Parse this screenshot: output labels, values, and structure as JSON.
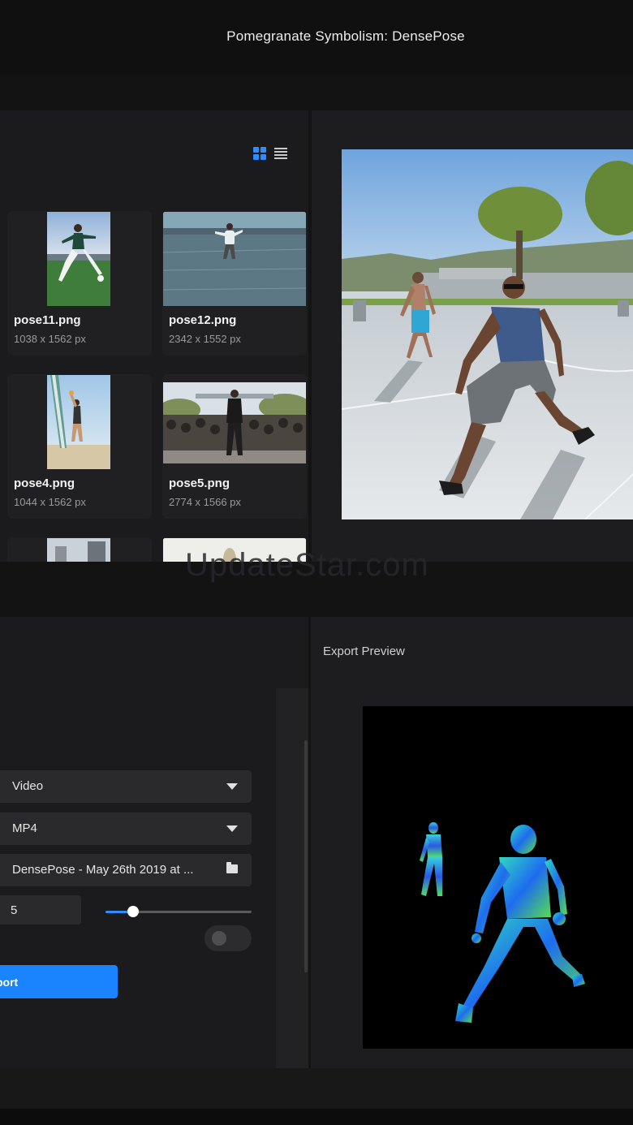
{
  "window": {
    "title": "Pomegranate Symbolism: DensePose"
  },
  "gallery": {
    "view_grid_icon": "grid-view-icon",
    "view_list_icon": "list-view-icon",
    "accent_color": "#2f8cff",
    "files": [
      {
        "name": "pose11.png",
        "size": "1038 x 1562 px"
      },
      {
        "name": "pose12.png",
        "size": "2342 x 1552 px"
      },
      {
        "name": "pose4.png",
        "size": "1044 x 1562 px"
      },
      {
        "name": "pose5.png",
        "size": "2774 x 1566 px"
      }
    ]
  },
  "watermark": "UpdateStar.com",
  "export": {
    "type_select": "Video",
    "format_select": "MP4",
    "destination": "DensePose - May 26th 2019 at ...",
    "folder_icon": "folder-icon",
    "fps_value": "5",
    "slider_value": 0.19,
    "toggle_on": false,
    "export_button": "port",
    "preview_title": "Export Preview"
  }
}
